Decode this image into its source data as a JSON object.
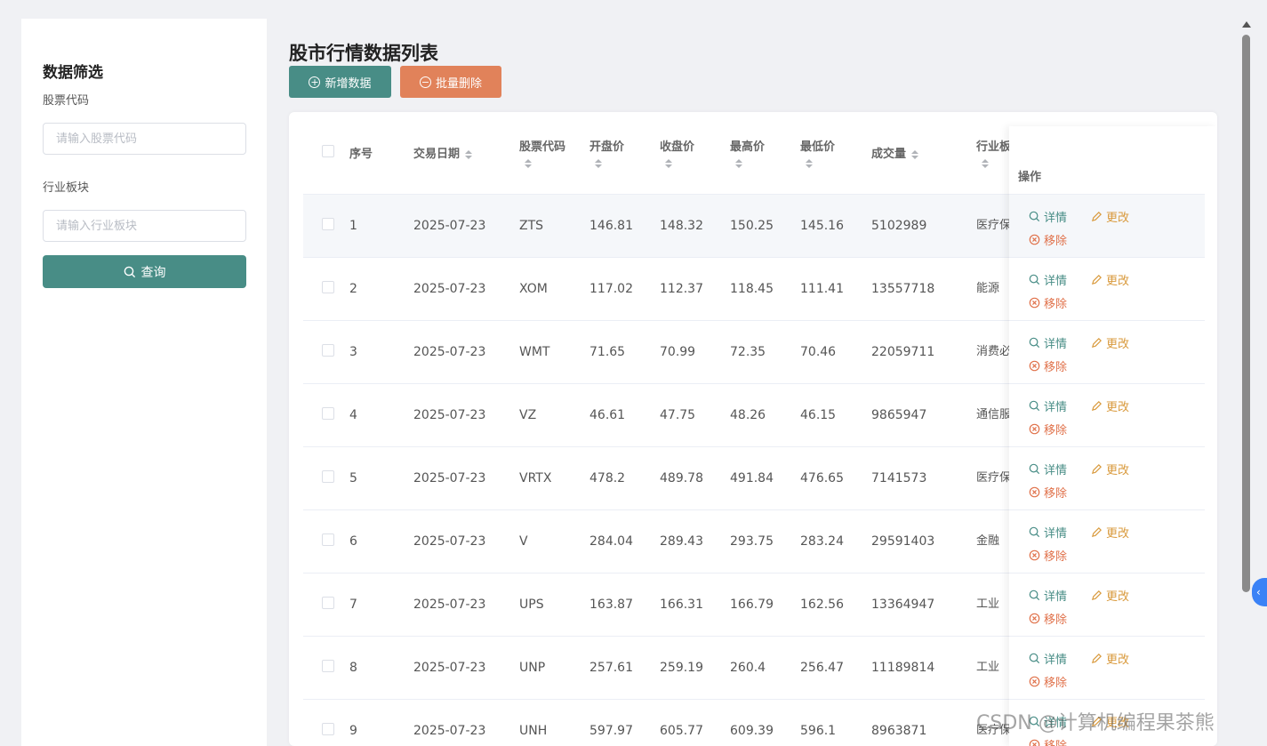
{
  "sidebar": {
    "title": "数据筛选",
    "code_label": "股票代码",
    "code_placeholder": "请输入股票代码",
    "sector_label": "行业板块",
    "sector_placeholder": "请输入行业板块",
    "search_button": "查询"
  },
  "main": {
    "title": "股市行情数据列表",
    "add_button": "新增数据",
    "batch_delete_button": "批量删除"
  },
  "table": {
    "headers": {
      "index": "序号",
      "date": "交易日期",
      "code": "股票代码",
      "open": "开盘价",
      "close": "收盘价",
      "high": "最高价",
      "low": "最低价",
      "volume": "成交量",
      "industry": "行业板",
      "ops": "操作"
    },
    "action_labels": {
      "view": "详情",
      "edit": "更改",
      "remove": "移除"
    },
    "rows": [
      {
        "idx": "1",
        "date": "2025-07-23",
        "code": "ZTS",
        "open": "146.81",
        "close": "148.32",
        "high": "150.25",
        "low": "145.16",
        "volume": "5102989",
        "industry": "医疗保"
      },
      {
        "idx": "2",
        "date": "2025-07-23",
        "code": "XOM",
        "open": "117.02",
        "close": "112.37",
        "high": "118.45",
        "low": "111.41",
        "volume": "13557718",
        "industry": "能源"
      },
      {
        "idx": "3",
        "date": "2025-07-23",
        "code": "WMT",
        "open": "71.65",
        "close": "70.99",
        "high": "72.35",
        "low": "70.46",
        "volume": "22059711",
        "industry": "消费必品"
      },
      {
        "idx": "4",
        "date": "2025-07-23",
        "code": "VZ",
        "open": "46.61",
        "close": "47.75",
        "high": "48.26",
        "low": "46.15",
        "volume": "9865947",
        "industry": "通信服"
      },
      {
        "idx": "5",
        "date": "2025-07-23",
        "code": "VRTX",
        "open": "478.2",
        "close": "489.78",
        "high": "491.84",
        "low": "476.65",
        "volume": "7141573",
        "industry": "医疗保"
      },
      {
        "idx": "6",
        "date": "2025-07-23",
        "code": "V",
        "open": "284.04",
        "close": "289.43",
        "high": "293.75",
        "low": "283.24",
        "volume": "29591403",
        "industry": "金融"
      },
      {
        "idx": "7",
        "date": "2025-07-23",
        "code": "UPS",
        "open": "163.87",
        "close": "166.31",
        "high": "166.79",
        "low": "162.56",
        "volume": "13364947",
        "industry": "工业"
      },
      {
        "idx": "8",
        "date": "2025-07-23",
        "code": "UNP",
        "open": "257.61",
        "close": "259.19",
        "high": "260.4",
        "low": "256.47",
        "volume": "11189814",
        "industry": "工业"
      },
      {
        "idx": "9",
        "date": "2025-07-23",
        "code": "UNH",
        "open": "597.97",
        "close": "605.77",
        "high": "609.39",
        "low": "596.1",
        "volume": "8963871",
        "industry": "医疗保"
      }
    ]
  },
  "watermark": "CSDN @计算机编程果茶熊",
  "colors": {
    "primary": "#488d86",
    "danger": "#e1825a",
    "edit": "#d99a3d",
    "remove": "#e0714a"
  }
}
